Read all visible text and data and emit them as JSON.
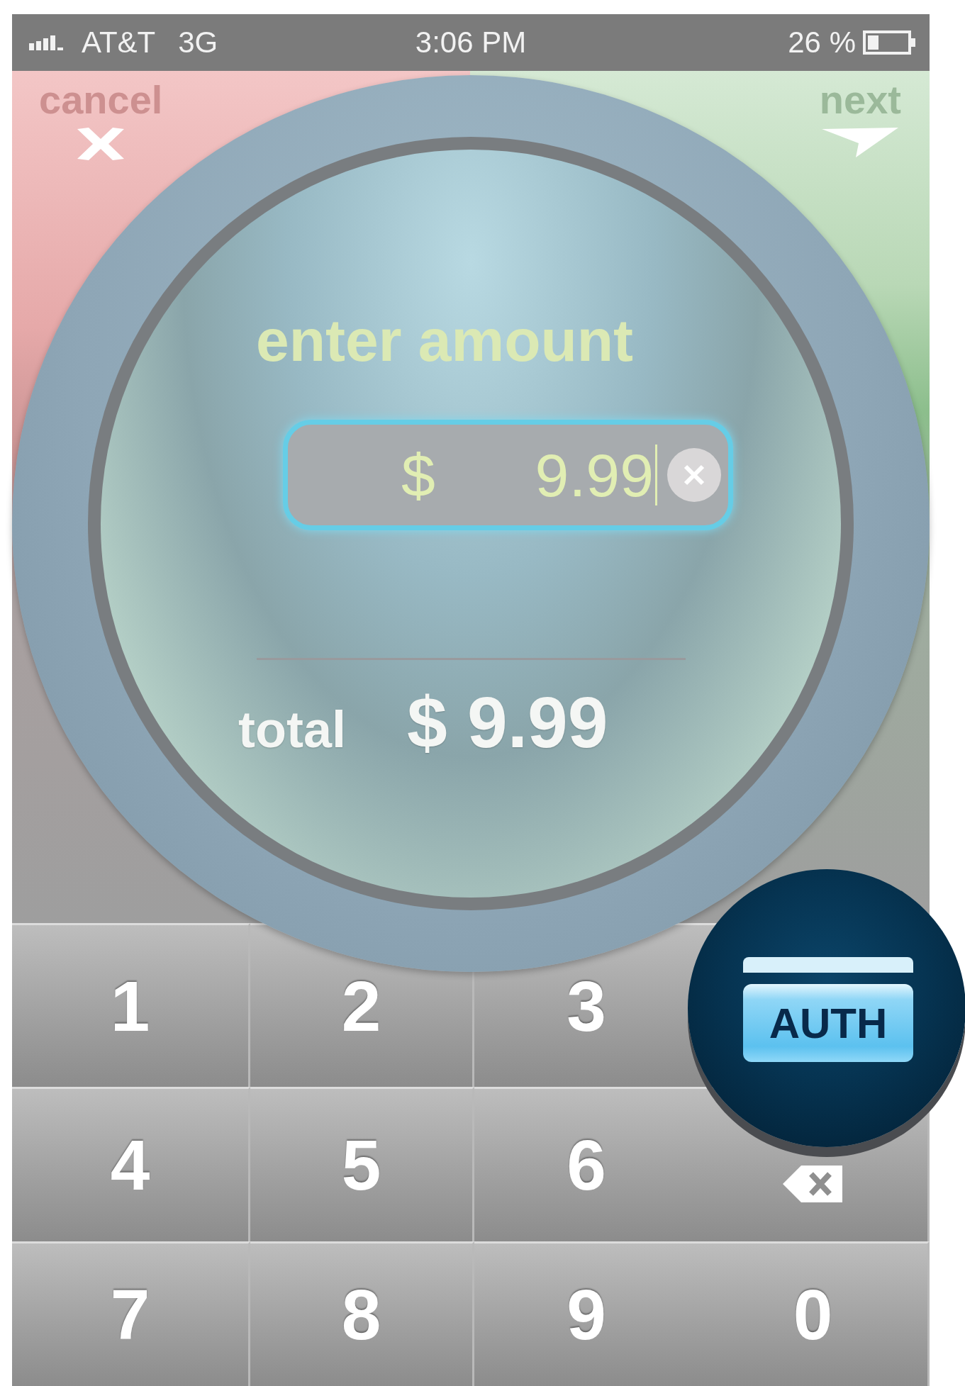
{
  "status_bar": {
    "carrier": "AT&T",
    "network": "3G",
    "time": "3:06 PM",
    "battery": "26 %"
  },
  "cancel": {
    "label": "cancel"
  },
  "next": {
    "label": "next"
  },
  "amount": {
    "title": "enter amount",
    "currency": "$",
    "value": "9.99"
  },
  "total": {
    "label": "total",
    "value": "$ 9.99"
  },
  "keypad": [
    {
      "kind": "digit",
      "label": "1"
    },
    {
      "kind": "digit",
      "label": "2"
    },
    {
      "kind": "digit",
      "label": "3"
    },
    {
      "kind": "blank"
    },
    {
      "kind": "digit",
      "label": "4"
    },
    {
      "kind": "digit",
      "label": "5"
    },
    {
      "kind": "digit",
      "label": "6"
    },
    {
      "kind": "backspace"
    },
    {
      "kind": "digit",
      "label": "7"
    },
    {
      "kind": "digit",
      "label": "8"
    },
    {
      "kind": "digit",
      "label": "9"
    },
    {
      "kind": "digit",
      "label": "0"
    }
  ],
  "auth": {
    "label": "AUTH"
  }
}
